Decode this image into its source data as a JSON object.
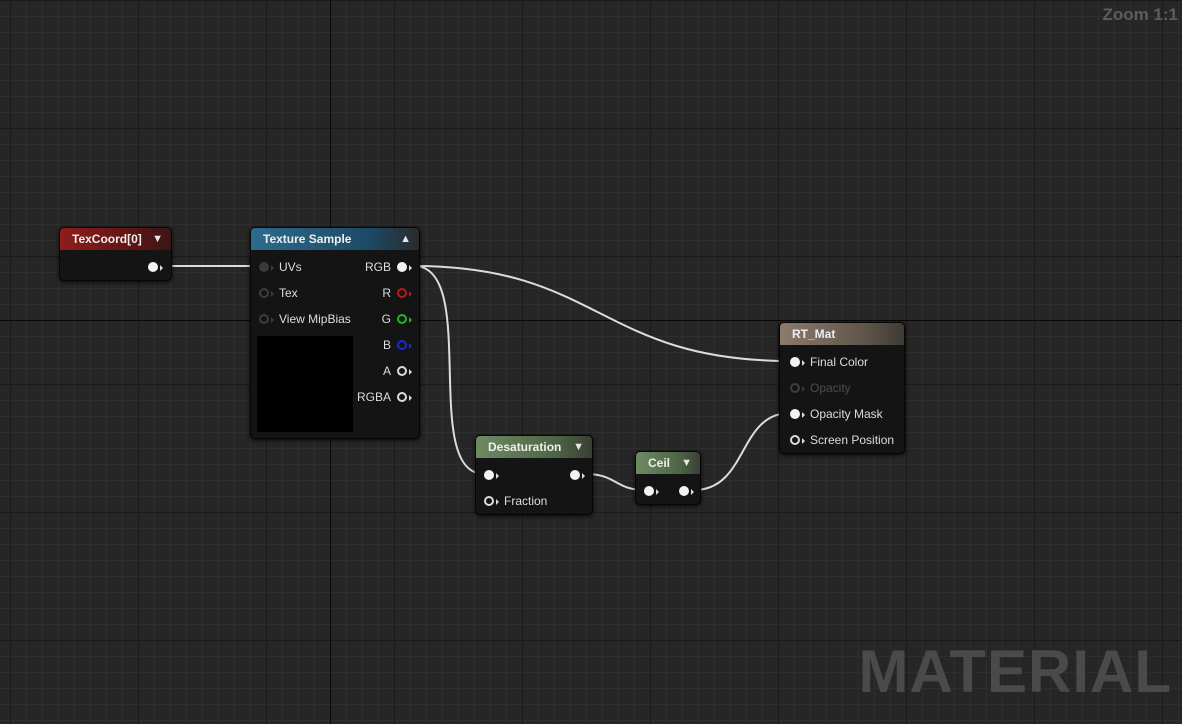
{
  "zoom_label": "Zoom 1:1",
  "watermark": "MATERIAL",
  "colors": {
    "texcoord_header": "#8f1d1d",
    "texture_sample_header": "#2d6b8c",
    "math_header": "#6f8a62",
    "result_header": "#8b7b6c",
    "wire": "#dcdcdc",
    "pin_r": "#c01818",
    "pin_g": "#1dbb1d",
    "pin_b": "#1a2bd6"
  },
  "nodes": {
    "texcoord": {
      "title": "TexCoord[0]"
    },
    "texture_sample": {
      "title": "Texture Sample",
      "inputs": [
        "UVs",
        "Tex",
        "View MipBias"
      ],
      "outputs": [
        "RGB",
        "R",
        "G",
        "B",
        "A",
        "RGBA"
      ]
    },
    "desaturation": {
      "title": "Desaturation",
      "inputs": [
        "Fraction"
      ]
    },
    "ceil": {
      "title": "Ceil"
    },
    "rt_mat": {
      "title": "RT_Mat",
      "inputs": [
        "Final Color",
        "Opacity",
        "Opacity Mask",
        "Screen Position"
      ]
    }
  }
}
